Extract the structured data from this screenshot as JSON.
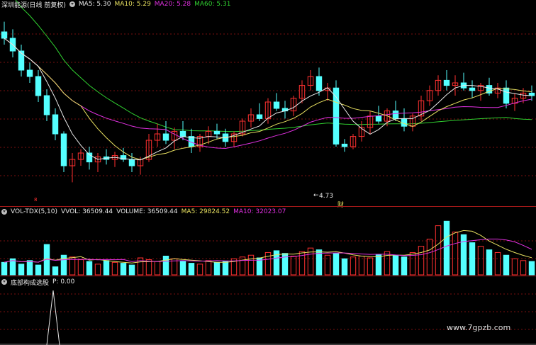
{
  "main": {
    "title": "深圳能源(日线 前复权)",
    "ma5": "MA5: 5.30",
    "ma10": "MA10: 5.29",
    "ma20": "MA20: 5.28",
    "ma60": "MA60: 5.31",
    "low_label": "4.73",
    "low_arrow": "←",
    "fin_marker": "财",
    "bottom_marker": "8"
  },
  "volume": {
    "title": "VOL-TDX(5,10)",
    "vvol": "VVOL: 36509.44",
    "volume": "VOLUME: 36509.44",
    "ma5": "MA5: 29824.52",
    "ma10": "MA10: 32023.07"
  },
  "indicator": {
    "title": "底部构成选股",
    "p": "P: 0.00"
  },
  "watermark": "www.7gpzb.com",
  "colors": {
    "up": "#ff3030",
    "down": "#54ffff",
    "ma5": "#e8e8e8",
    "ma10": "#e8e060",
    "ma20": "#e030e0",
    "ma60": "#30d030",
    "divider": "#a01818",
    "grid": "#7a1010"
  },
  "chart_data": {
    "type": "candlestick",
    "series_note": "daily candles, open/high/low/close in price units",
    "candles": [
      [
        5.9,
        5.98,
        5.8,
        5.85
      ],
      [
        5.85,
        5.92,
        5.7,
        5.75
      ],
      [
        5.75,
        5.8,
        5.55,
        5.6
      ],
      [
        5.6,
        5.66,
        5.5,
        5.55
      ],
      [
        5.55,
        5.6,
        5.35,
        5.4
      ],
      [
        5.4,
        5.45,
        5.2,
        5.25
      ],
      [
        5.25,
        5.3,
        5.05,
        5.1
      ],
      [
        5.1,
        5.12,
        4.8,
        4.85
      ],
      [
        4.85,
        4.95,
        4.72,
        4.9
      ],
      [
        4.9,
        4.98,
        4.85,
        4.95
      ],
      [
        4.95,
        5.0,
        4.82,
        4.88
      ],
      [
        4.88,
        4.95,
        4.8,
        4.92
      ],
      [
        4.92,
        4.98,
        4.86,
        4.9
      ],
      [
        4.9,
        4.96,
        4.84,
        4.93
      ],
      [
        4.93,
        4.99,
        4.88,
        4.9
      ],
      [
        4.9,
        4.95,
        4.8,
        4.85
      ],
      [
        4.85,
        4.92,
        4.78,
        4.9
      ],
      [
        4.9,
        5.1,
        4.88,
        5.05
      ],
      [
        5.05,
        5.18,
        5.0,
        5.1
      ],
      [
        5.1,
        5.2,
        5.02,
        5.05
      ],
      [
        5.05,
        5.15,
        4.98,
        5.12
      ],
      [
        5.12,
        5.2,
        5.05,
        5.08
      ],
      [
        5.08,
        5.14,
        4.95,
        5.0
      ],
      [
        5.0,
        5.1,
        4.96,
        5.08
      ],
      [
        5.08,
        5.16,
        5.02,
        5.12
      ],
      [
        5.12,
        5.18,
        5.06,
        5.1
      ],
      [
        5.1,
        5.14,
        5.0,
        5.04
      ],
      [
        5.04,
        5.12,
        5.0,
        5.1
      ],
      [
        5.1,
        5.22,
        5.08,
        5.2
      ],
      [
        5.2,
        5.3,
        5.15,
        5.25
      ],
      [
        5.25,
        5.34,
        5.2,
        5.22
      ],
      [
        5.22,
        5.38,
        5.18,
        5.35
      ],
      [
        5.35,
        5.42,
        5.28,
        5.3
      ],
      [
        5.3,
        5.36,
        5.22,
        5.28
      ],
      [
        5.28,
        5.4,
        5.24,
        5.38
      ],
      [
        5.38,
        5.52,
        5.34,
        5.48
      ],
      [
        5.48,
        5.6,
        5.44,
        5.55
      ],
      [
        5.55,
        5.62,
        5.4,
        5.44
      ],
      [
        5.44,
        5.5,
        5.36,
        5.46
      ],
      [
        5.46,
        5.52,
        5.0,
        5.02
      ],
      [
        5.02,
        5.06,
        4.96,
        5.0
      ],
      [
        5.0,
        5.1,
        4.98,
        5.08
      ],
      [
        5.08,
        5.2,
        5.04,
        5.15
      ],
      [
        5.15,
        5.28,
        5.1,
        5.24
      ],
      [
        5.24,
        5.32,
        5.18,
        5.2
      ],
      [
        5.2,
        5.3,
        5.16,
        5.28
      ],
      [
        5.28,
        5.36,
        5.2,
        5.22
      ],
      [
        5.22,
        5.3,
        5.12,
        5.16
      ],
      [
        5.16,
        5.26,
        5.12,
        5.24
      ],
      [
        5.24,
        5.4,
        5.2,
        5.36
      ],
      [
        5.36,
        5.48,
        5.32,
        5.44
      ],
      [
        5.44,
        5.56,
        5.4,
        5.52
      ],
      [
        5.52,
        5.6,
        5.44,
        5.48
      ],
      [
        5.48,
        5.56,
        5.4,
        5.5
      ],
      [
        5.5,
        5.58,
        5.44,
        5.46
      ],
      [
        5.46,
        5.52,
        5.38,
        5.44
      ],
      [
        5.44,
        5.5,
        5.36,
        5.48
      ],
      [
        5.48,
        5.54,
        5.4,
        5.42
      ],
      [
        5.42,
        5.5,
        5.38,
        5.46
      ],
      [
        5.46,
        5.52,
        5.3,
        5.34
      ],
      [
        5.34,
        5.42,
        5.28,
        5.38
      ],
      [
        5.38,
        5.46,
        5.34,
        5.42
      ],
      [
        5.42,
        5.48,
        5.36,
        5.4
      ]
    ],
    "volumes": [
      14000,
      18000,
      12000,
      16000,
      11000,
      34000,
      9000,
      22000,
      20000,
      17000,
      15000,
      12000,
      16000,
      14000,
      13000,
      11000,
      19000,
      17000,
      15000,
      21000,
      18000,
      15000,
      13000,
      12000,
      16000,
      14000,
      15000,
      18000,
      20000,
      22000,
      19000,
      25000,
      27000,
      24000,
      21000,
      26000,
      30000,
      28000,
      22000,
      24000,
      18000,
      20000,
      21000,
      19000,
      23000,
      26000,
      22000,
      20000,
      25000,
      32000,
      40000,
      55000,
      60000,
      48000,
      45000,
      36000,
      32000,
      28000,
      25000,
      22000,
      18000,
      16000,
      15000
    ]
  }
}
